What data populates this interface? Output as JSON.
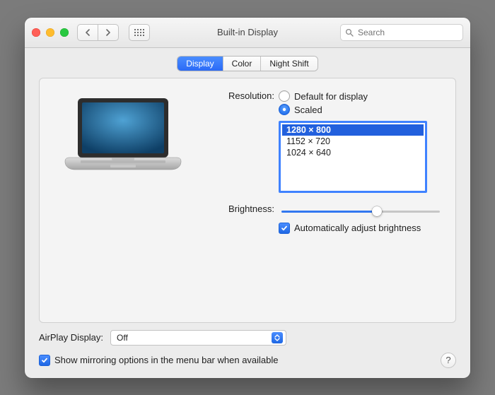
{
  "window": {
    "title": "Built-in Display"
  },
  "toolbar": {
    "search_placeholder": "Search"
  },
  "tabs": {
    "display": "Display",
    "color": "Color",
    "night_shift": "Night Shift",
    "active": "display"
  },
  "resolution": {
    "label": "Resolution:",
    "default_label": "Default for display",
    "scaled_label": "Scaled",
    "selected_mode": "scaled",
    "options": [
      "1280 × 800",
      "1152 × 720",
      "1024 × 640"
    ],
    "selected_option": "1280 × 800"
  },
  "brightness": {
    "label": "Brightness:",
    "value_pct": 60,
    "auto_label": "Automatically adjust brightness",
    "auto_checked": true
  },
  "airplay": {
    "label": "AirPlay Display:",
    "value": "Off"
  },
  "mirroring": {
    "label": "Show mirroring options in the menu bar when available",
    "checked": true
  },
  "help": {
    "label": "?"
  }
}
